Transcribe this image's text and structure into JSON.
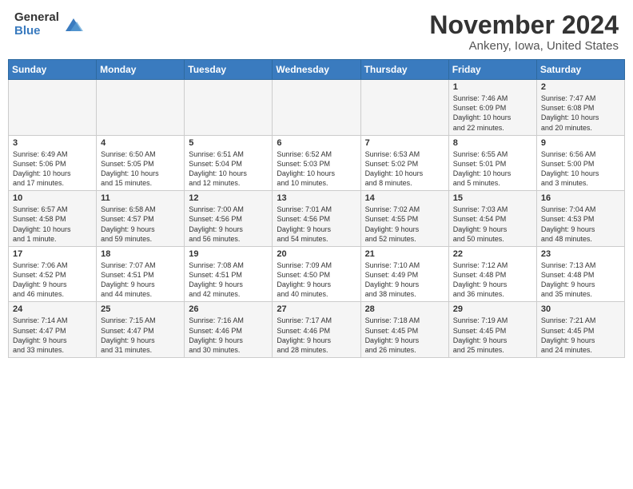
{
  "header": {
    "logo_general": "General",
    "logo_blue": "Blue",
    "month_title": "November 2024",
    "location": "Ankeny, Iowa, United States"
  },
  "weekdays": [
    "Sunday",
    "Monday",
    "Tuesday",
    "Wednesday",
    "Thursday",
    "Friday",
    "Saturday"
  ],
  "weeks": [
    [
      {
        "day": "",
        "info": ""
      },
      {
        "day": "",
        "info": ""
      },
      {
        "day": "",
        "info": ""
      },
      {
        "day": "",
        "info": ""
      },
      {
        "day": "",
        "info": ""
      },
      {
        "day": "1",
        "info": "Sunrise: 7:46 AM\nSunset: 6:09 PM\nDaylight: 10 hours\nand 22 minutes."
      },
      {
        "day": "2",
        "info": "Sunrise: 7:47 AM\nSunset: 6:08 PM\nDaylight: 10 hours\nand 20 minutes."
      }
    ],
    [
      {
        "day": "3",
        "info": "Sunrise: 6:49 AM\nSunset: 5:06 PM\nDaylight: 10 hours\nand 17 minutes."
      },
      {
        "day": "4",
        "info": "Sunrise: 6:50 AM\nSunset: 5:05 PM\nDaylight: 10 hours\nand 15 minutes."
      },
      {
        "day": "5",
        "info": "Sunrise: 6:51 AM\nSunset: 5:04 PM\nDaylight: 10 hours\nand 12 minutes."
      },
      {
        "day": "6",
        "info": "Sunrise: 6:52 AM\nSunset: 5:03 PM\nDaylight: 10 hours\nand 10 minutes."
      },
      {
        "day": "7",
        "info": "Sunrise: 6:53 AM\nSunset: 5:02 PM\nDaylight: 10 hours\nand 8 minutes."
      },
      {
        "day": "8",
        "info": "Sunrise: 6:55 AM\nSunset: 5:01 PM\nDaylight: 10 hours\nand 5 minutes."
      },
      {
        "day": "9",
        "info": "Sunrise: 6:56 AM\nSunset: 5:00 PM\nDaylight: 10 hours\nand 3 minutes."
      }
    ],
    [
      {
        "day": "10",
        "info": "Sunrise: 6:57 AM\nSunset: 4:58 PM\nDaylight: 10 hours\nand 1 minute."
      },
      {
        "day": "11",
        "info": "Sunrise: 6:58 AM\nSunset: 4:57 PM\nDaylight: 9 hours\nand 59 minutes."
      },
      {
        "day": "12",
        "info": "Sunrise: 7:00 AM\nSunset: 4:56 PM\nDaylight: 9 hours\nand 56 minutes."
      },
      {
        "day": "13",
        "info": "Sunrise: 7:01 AM\nSunset: 4:56 PM\nDaylight: 9 hours\nand 54 minutes."
      },
      {
        "day": "14",
        "info": "Sunrise: 7:02 AM\nSunset: 4:55 PM\nDaylight: 9 hours\nand 52 minutes."
      },
      {
        "day": "15",
        "info": "Sunrise: 7:03 AM\nSunset: 4:54 PM\nDaylight: 9 hours\nand 50 minutes."
      },
      {
        "day": "16",
        "info": "Sunrise: 7:04 AM\nSunset: 4:53 PM\nDaylight: 9 hours\nand 48 minutes."
      }
    ],
    [
      {
        "day": "17",
        "info": "Sunrise: 7:06 AM\nSunset: 4:52 PM\nDaylight: 9 hours\nand 46 minutes."
      },
      {
        "day": "18",
        "info": "Sunrise: 7:07 AM\nSunset: 4:51 PM\nDaylight: 9 hours\nand 44 minutes."
      },
      {
        "day": "19",
        "info": "Sunrise: 7:08 AM\nSunset: 4:51 PM\nDaylight: 9 hours\nand 42 minutes."
      },
      {
        "day": "20",
        "info": "Sunrise: 7:09 AM\nSunset: 4:50 PM\nDaylight: 9 hours\nand 40 minutes."
      },
      {
        "day": "21",
        "info": "Sunrise: 7:10 AM\nSunset: 4:49 PM\nDaylight: 9 hours\nand 38 minutes."
      },
      {
        "day": "22",
        "info": "Sunrise: 7:12 AM\nSunset: 4:48 PM\nDaylight: 9 hours\nand 36 minutes."
      },
      {
        "day": "23",
        "info": "Sunrise: 7:13 AM\nSunset: 4:48 PM\nDaylight: 9 hours\nand 35 minutes."
      }
    ],
    [
      {
        "day": "24",
        "info": "Sunrise: 7:14 AM\nSunset: 4:47 PM\nDaylight: 9 hours\nand 33 minutes."
      },
      {
        "day": "25",
        "info": "Sunrise: 7:15 AM\nSunset: 4:47 PM\nDaylight: 9 hours\nand 31 minutes."
      },
      {
        "day": "26",
        "info": "Sunrise: 7:16 AM\nSunset: 4:46 PM\nDaylight: 9 hours\nand 30 minutes."
      },
      {
        "day": "27",
        "info": "Sunrise: 7:17 AM\nSunset: 4:46 PM\nDaylight: 9 hours\nand 28 minutes."
      },
      {
        "day": "28",
        "info": "Sunrise: 7:18 AM\nSunset: 4:45 PM\nDaylight: 9 hours\nand 26 minutes."
      },
      {
        "day": "29",
        "info": "Sunrise: 7:19 AM\nSunset: 4:45 PM\nDaylight: 9 hours\nand 25 minutes."
      },
      {
        "day": "30",
        "info": "Sunrise: 7:21 AM\nSunset: 4:45 PM\nDaylight: 9 hours\nand 24 minutes."
      }
    ]
  ]
}
